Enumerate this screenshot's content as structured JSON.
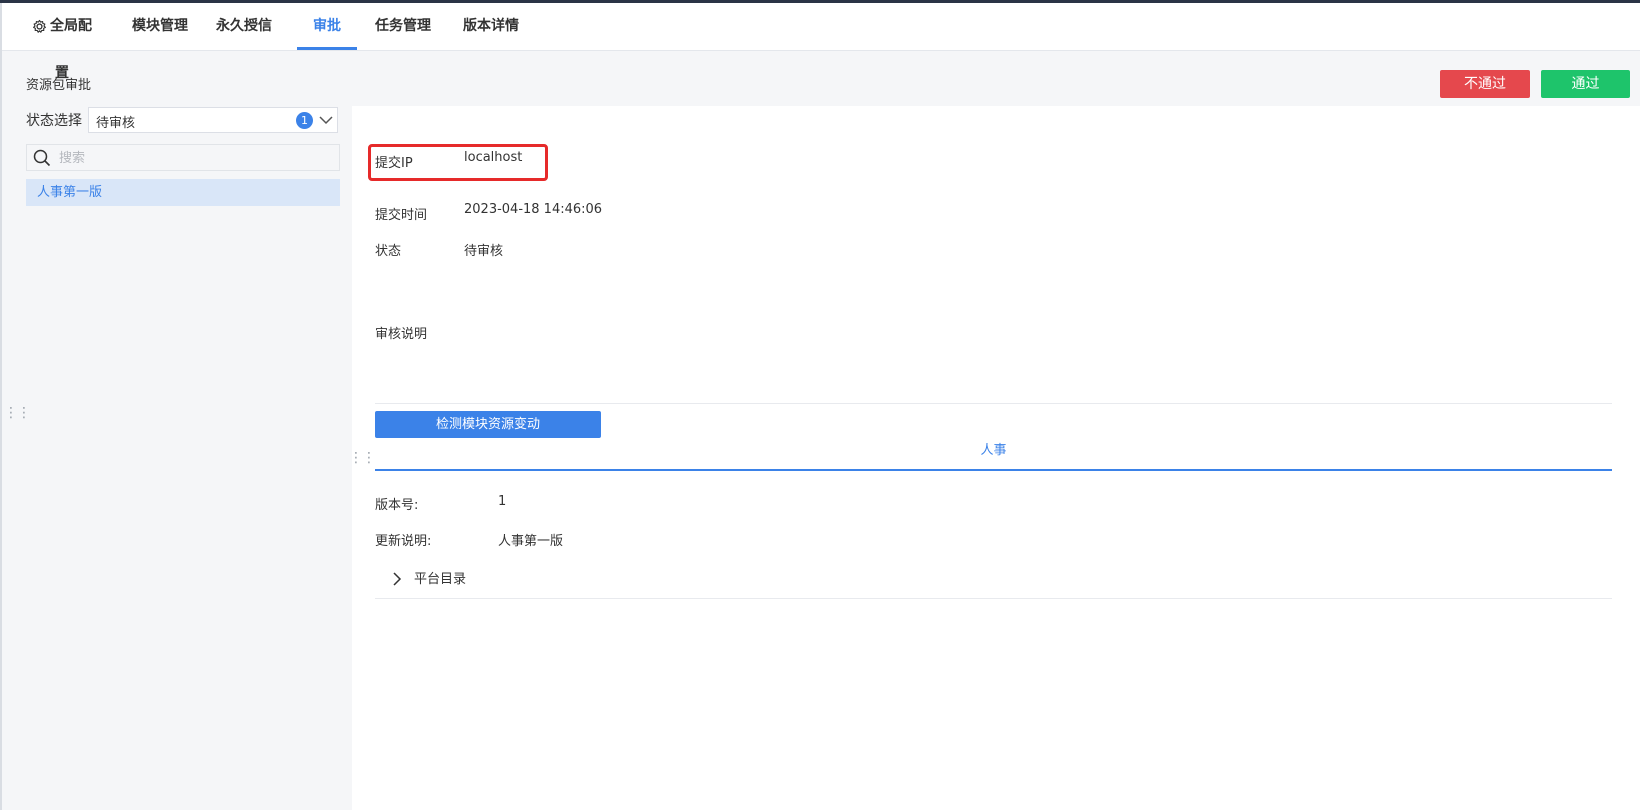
{
  "nav": {
    "items": [
      {
        "label": "全局配置",
        "icon": "gear-icon"
      },
      {
        "label": "模块管理"
      },
      {
        "label": "永久授信"
      },
      {
        "label": "审批",
        "active": true
      },
      {
        "label": "任务管理"
      },
      {
        "label": "版本详情"
      }
    ]
  },
  "sidebar": {
    "title": "资源包审批",
    "status_label": "状态选择",
    "status_value": "待审核",
    "status_count": "1",
    "search_placeholder": "搜索",
    "items": [
      {
        "label": "人事第一版"
      }
    ]
  },
  "actions": {
    "reject_label": "不通过",
    "approve_label": "通过",
    "reject_color": "#e5484d",
    "approve_color": "#1ec46b"
  },
  "detail": {
    "ip_label": "提交IP",
    "ip_value": "localhost",
    "time_label": "提交时间",
    "time_value": "2023-04-18 14:46:06",
    "status_label": "状态",
    "status_value": "待审核",
    "note_label": "审核说明",
    "detect_button": "检测模块资源变动",
    "module_tab": "人事",
    "version_label": "版本号:",
    "version_value": "1",
    "update_label": "更新说明:",
    "update_value": "人事第一版",
    "tree_item": "平台目录"
  },
  "accent_color": "#3b82e8"
}
